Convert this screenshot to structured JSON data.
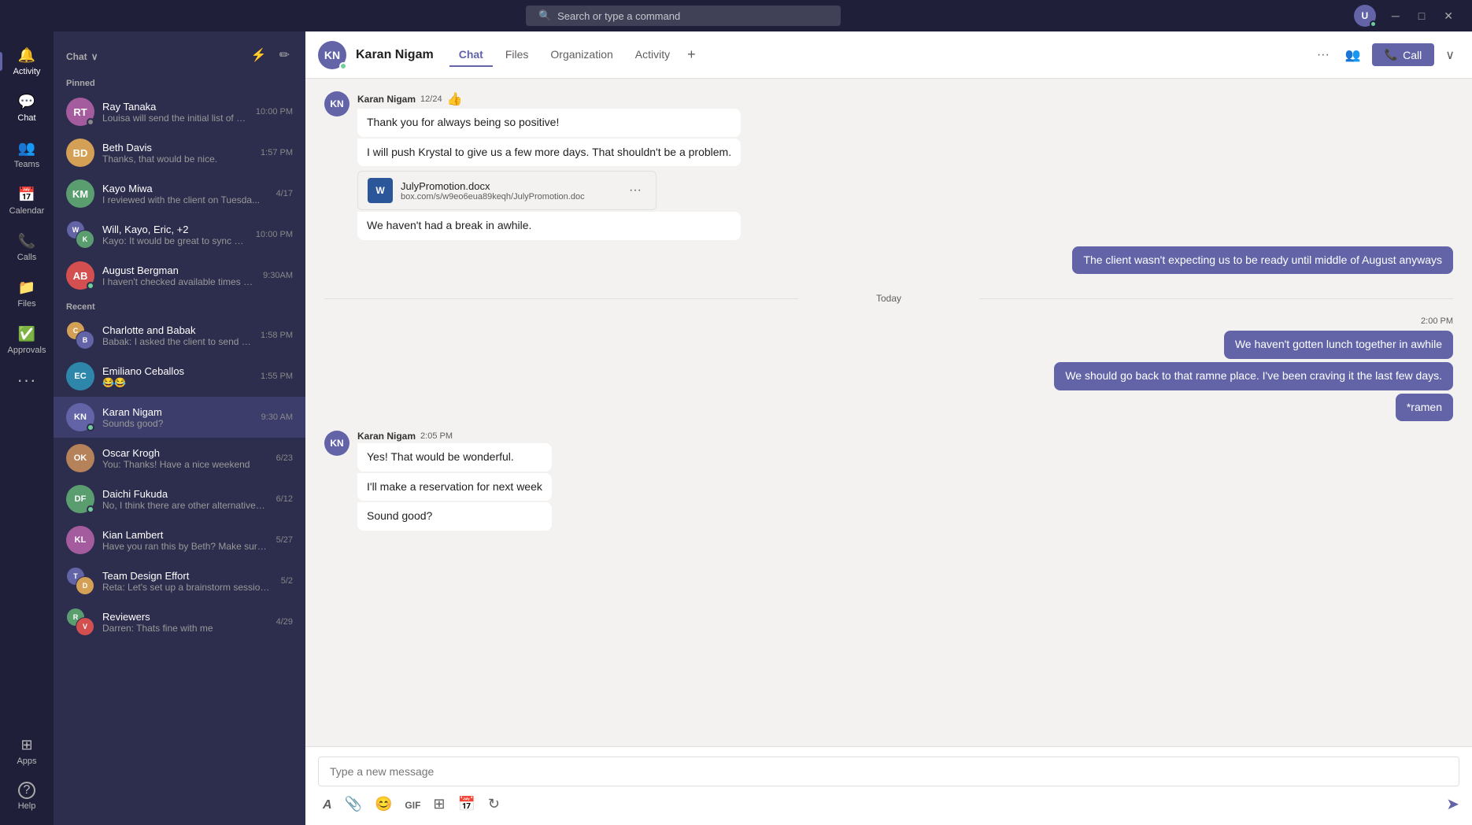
{
  "window": {
    "search_placeholder": "Search or type a command",
    "minimize": "─",
    "maximize": "□",
    "close": "✕",
    "user_initials": "U"
  },
  "nav": {
    "items": [
      {
        "id": "activity",
        "label": "Activity",
        "icon": "🔔"
      },
      {
        "id": "chat",
        "label": "Chat",
        "icon": "💬",
        "active": true
      },
      {
        "id": "teams",
        "label": "Teams",
        "icon": "👥"
      },
      {
        "id": "calendar",
        "label": "Calendar",
        "icon": "📅"
      },
      {
        "id": "calls",
        "label": "Calls",
        "icon": "📞"
      },
      {
        "id": "files",
        "label": "Files",
        "icon": "📁"
      },
      {
        "id": "approvals",
        "label": "Approvals",
        "icon": "✅"
      },
      {
        "id": "more",
        "label": "···",
        "icon": "···"
      }
    ],
    "bottom": [
      {
        "id": "apps",
        "label": "Apps",
        "icon": "⊞"
      },
      {
        "id": "help",
        "label": "Help",
        "icon": "?"
      }
    ]
  },
  "sidebar": {
    "title": "Chat",
    "title_chevron": "∨",
    "filter_icon": "filter",
    "compose_icon": "compose",
    "sections": {
      "pinned": {
        "label": "Pinned",
        "chats": [
          {
            "id": "ray",
            "name": "Ray Tanaka",
            "preview": "Louisa will send the initial list of atte...",
            "time": "10:00 PM",
            "initials": "RT",
            "color": "#a45c9e",
            "status": "none"
          },
          {
            "id": "beth",
            "name": "Beth Davis",
            "preview": "Thanks, that would be nice.",
            "time": "1:57 PM",
            "initials": "BD",
            "color": "#d4a055",
            "status": "none"
          },
          {
            "id": "kayo",
            "name": "Kayo Miwa",
            "preview": "I reviewed with the client on Tuesda...",
            "time": "4/17",
            "initials": "KM",
            "color": "#5a9e6f",
            "status": "none"
          },
          {
            "id": "will",
            "name": "Will, Kayo, Eric, +2",
            "preview": "Kayo: It would be great to sync with...",
            "time": "10:00 PM",
            "initials": "WK",
            "color": "#6264a7",
            "status": "none",
            "group": true
          },
          {
            "id": "august",
            "name": "August Bergman",
            "preview": "I haven't checked available times yet",
            "time": "9:30AM",
            "initials": "AB",
            "color": "#d44f4f",
            "status": "online"
          }
        ]
      },
      "recent": {
        "label": "Recent",
        "chats": [
          {
            "id": "charlotte",
            "name": "Charlotte and Babak",
            "preview": "Babak: I asked the client to send her feed...",
            "time": "1:58 PM",
            "initials": "CB",
            "color": "#6264a7",
            "status": "none",
            "group": true
          },
          {
            "id": "emiliano",
            "name": "Emiliano Ceballos",
            "preview": "😂😂",
            "time": "1:55 PM",
            "initials": "EC",
            "color": "#2e86ab",
            "status": "none"
          },
          {
            "id": "karan",
            "name": "Karan Nigam",
            "preview": "Sounds good?",
            "time": "9:30 AM",
            "initials": "KN",
            "color": "#6264a7",
            "status": "online",
            "active": true
          },
          {
            "id": "oscar",
            "name": "Oscar Krogh",
            "preview": "You: Thanks! Have a nice weekend",
            "time": "6/23",
            "initials": "OK",
            "color": "#b5825a",
            "status": "none"
          },
          {
            "id": "daichi",
            "name": "Daichi Fukuda",
            "preview": "No, I think there are other alternatives we c...",
            "time": "6/12",
            "initials": "DF",
            "color": "#5a9e6f",
            "status": "online"
          },
          {
            "id": "kian",
            "name": "Kian Lambert",
            "preview": "Have you ran this by Beth? Make sure she is...",
            "time": "5/27",
            "initials": "KL",
            "color": "#a45c9e",
            "status": "none"
          },
          {
            "id": "teamdesign",
            "name": "Team Design Effort",
            "preview": "Reta: Let's set up a brainstorm session for...",
            "time": "5/2",
            "initials": "TD",
            "color": "#6264a7",
            "status": "none",
            "group": true
          },
          {
            "id": "reviewers",
            "name": "Reviewers",
            "preview": "Darren: Thats fine with me",
            "time": "4/29",
            "initials": "RV",
            "color": "#6264a7",
            "status": "none",
            "group": true
          }
        ]
      }
    }
  },
  "chat": {
    "contact_name": "Karan Nigam",
    "contact_initials": "KN",
    "contact_color": "#6264a7",
    "contact_status": "online",
    "tabs": [
      {
        "id": "chat",
        "label": "Chat",
        "active": true
      },
      {
        "id": "files",
        "label": "Files"
      },
      {
        "id": "organization",
        "label": "Organization"
      },
      {
        "id": "activity",
        "label": "Activity"
      }
    ],
    "call_label": "Call",
    "more_icon": "···",
    "participants_icon": "👥",
    "expand_icon": "∨",
    "messages": [
      {
        "id": "m1",
        "type": "incoming",
        "sender": "Karan Nigam",
        "time": "12/24",
        "emoji": "👍",
        "bubbles": [
          "Thank you for always being so positive!",
          "I will push Krystal to give us a few more days. That shouldn't be a problem.",
          "We haven't had a break in awhile."
        ],
        "attachment": {
          "name": "JulyPromotion.docx",
          "url": "box.com/s/w9eo6eua89keqh/JulyPromotion.doc",
          "icon": "W"
        }
      },
      {
        "id": "m2",
        "type": "outgoing",
        "bubbles": [
          "The client wasn't expecting us to be ready until middle of August anyways"
        ]
      },
      {
        "id": "m3",
        "type": "divider",
        "label": "Today"
      },
      {
        "id": "m4",
        "type": "outgoing",
        "time": "2:00 PM",
        "bubbles": [
          "We haven't gotten lunch together in awhile",
          "We should go back to that ramne place. I've been craving it the last few days.",
          "*ramen"
        ]
      },
      {
        "id": "m5",
        "type": "incoming",
        "sender": "Karan Nigam",
        "time": "2:05 PM",
        "bubbles": [
          "Yes! That would be wonderful.",
          "I'll make a reservation for next week",
          "Sound good?"
        ]
      }
    ],
    "input_placeholder": "Type a new message"
  },
  "toolbar": {
    "format": "A",
    "attach": "📎",
    "emoji": "😊",
    "giphy": "GIF",
    "sticker": "⊞",
    "schedule": "📅",
    "loop": "↺",
    "send": "➤"
  }
}
